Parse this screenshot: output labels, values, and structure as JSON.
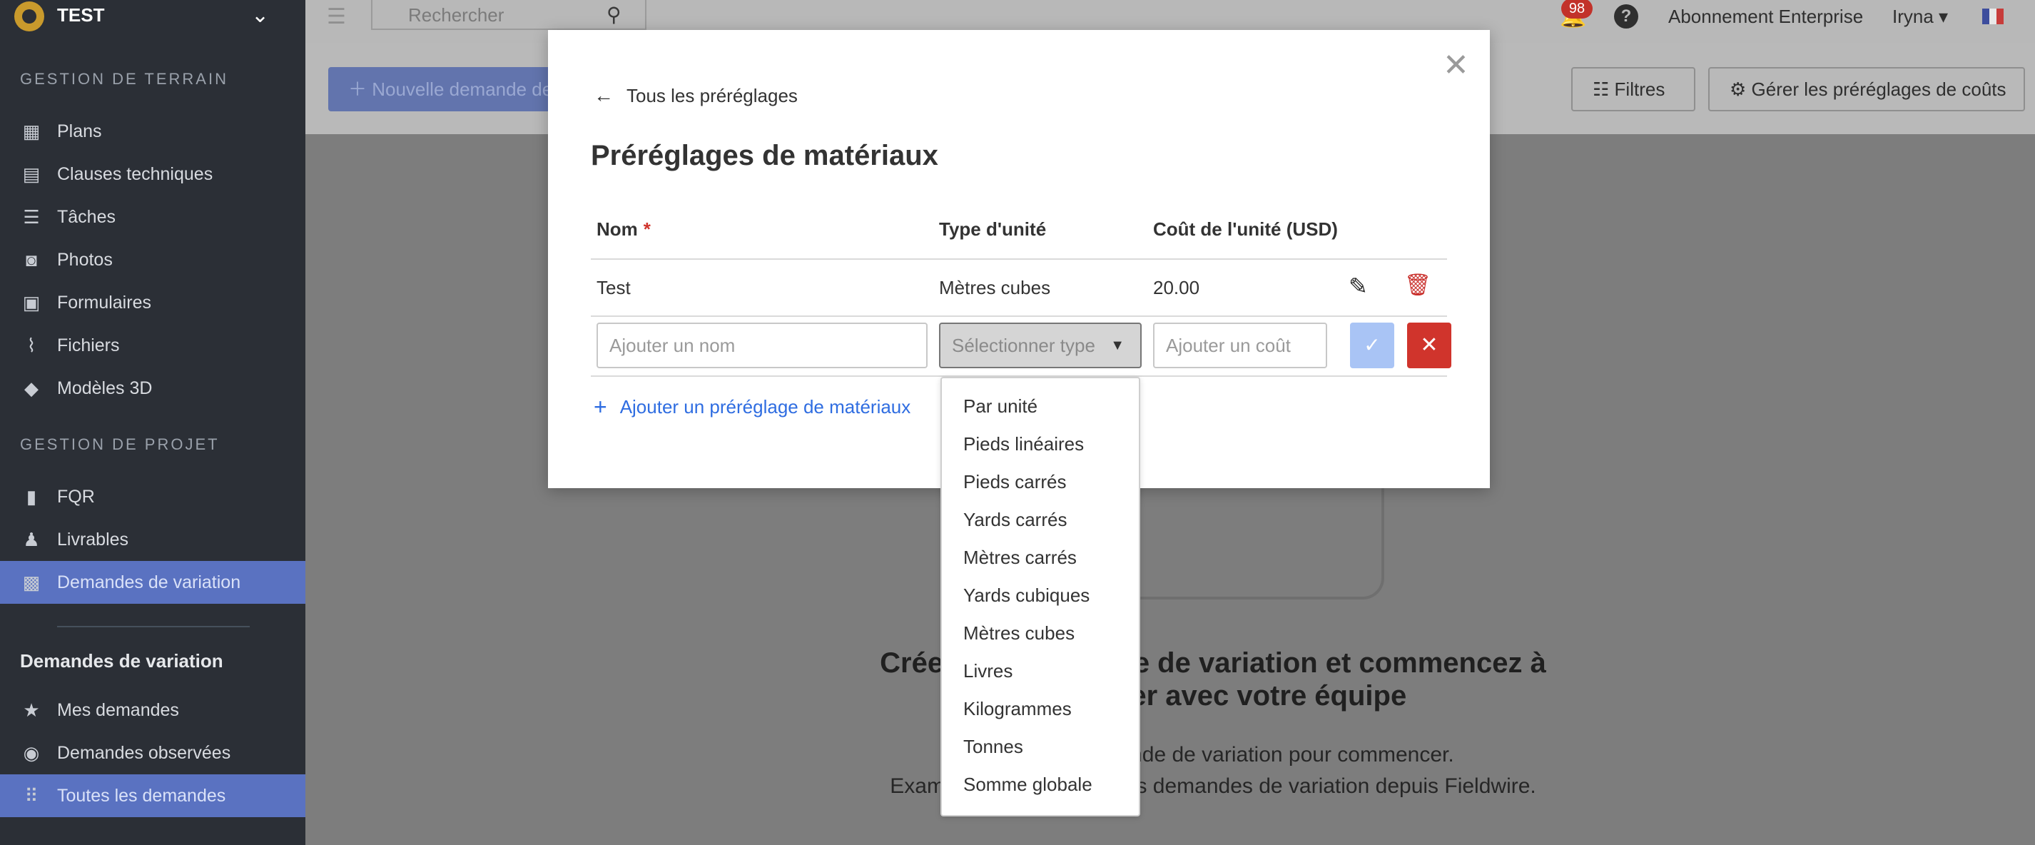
{
  "sidebar": {
    "project": "TEST",
    "section1": "GESTION DE TERRAIN",
    "items1": [
      {
        "label": "Plans",
        "icon": "plans-icon"
      },
      {
        "label": "Clauses techniques",
        "icon": "specs-icon"
      },
      {
        "label": "Tâches",
        "icon": "tasks-icon"
      },
      {
        "label": "Photos",
        "icon": "camera-icon"
      },
      {
        "label": "Formulaires",
        "icon": "forms-icon"
      },
      {
        "label": "Fichiers",
        "icon": "paperclip-icon"
      },
      {
        "label": "Modèles 3D",
        "icon": "cube-icon"
      }
    ],
    "section2": "GESTION DE PROJET",
    "items2": [
      {
        "label": "FQR",
        "icon": "rfi-icon"
      },
      {
        "label": "Livrables",
        "icon": "submittals-icon"
      },
      {
        "label": "Demandes de variation",
        "icon": "change-orders-icon"
      }
    ],
    "subtitle": "Demandes de variation",
    "items3": [
      {
        "label": "Mes demandes",
        "icon": "star-icon"
      },
      {
        "label": "Demandes observées",
        "icon": "eye-icon"
      },
      {
        "label": "Toutes les demandes",
        "icon": "grid-icon"
      }
    ]
  },
  "topbar": {
    "search_placeholder": "Rechercher",
    "notifications": "98",
    "help": "?",
    "plan": "Abonnement Enterprise",
    "user": "Iryna",
    "user_caret": "▾"
  },
  "toolbar": {
    "new_request": "Nouvelle demande de variation",
    "filters": "Filtres",
    "manage": "Gérer les préréglages de coûts"
  },
  "empty": {
    "title_line1": "Créez une demande de variation et commencez à",
    "title_line2": "collaborer avec votre équipe",
    "text_line1": "Créez une demande de variation pour commencer.",
    "text_line2": "Examinez et approuvez les demandes de variation depuis Fieldwire."
  },
  "modal": {
    "back_label": "Tous les préréglages",
    "title": "Préréglages de matériaux",
    "columns": {
      "name": "Nom",
      "required": "*",
      "unit_type": "Type d'unité",
      "unit_cost": "Coût de l'unité (USD)"
    },
    "row": {
      "name": "Test",
      "unit_type": "Mètres cubes",
      "unit_cost": "20.00"
    },
    "new_row": {
      "name_placeholder": "Ajouter un nom",
      "type_placeholder": "Sélectionner type",
      "cost_placeholder": "Ajouter un coût"
    },
    "add_label": "Ajouter un préréglage de matériaux"
  },
  "unit_options": [
    "Par unité",
    "Pieds linéaires",
    "Pieds carrés",
    "Yards carrés",
    "Mètres carrés",
    "Yards cubiques",
    "Mètres cubes",
    "Livres",
    "Kilogrammes",
    "Tonnes",
    "Somme globale"
  ]
}
